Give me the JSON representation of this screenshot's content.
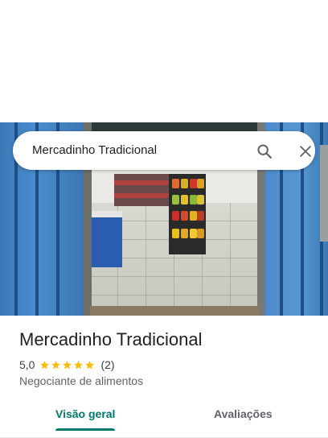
{
  "search": {
    "query": "Mercadinho Tradicional",
    "search_icon": "search-icon",
    "close_icon": "close-icon"
  },
  "place": {
    "name": "Mercadinho Tradicional",
    "rating": "5,0",
    "stars": 5,
    "review_count": "(2)",
    "category": "Negociante de alimentos"
  },
  "tabs": [
    {
      "label": "Visão geral",
      "selected": true
    },
    {
      "label": "Avaliações",
      "selected": false
    }
  ],
  "colors": {
    "accent": "#00796b",
    "star": "#fbbc04"
  }
}
